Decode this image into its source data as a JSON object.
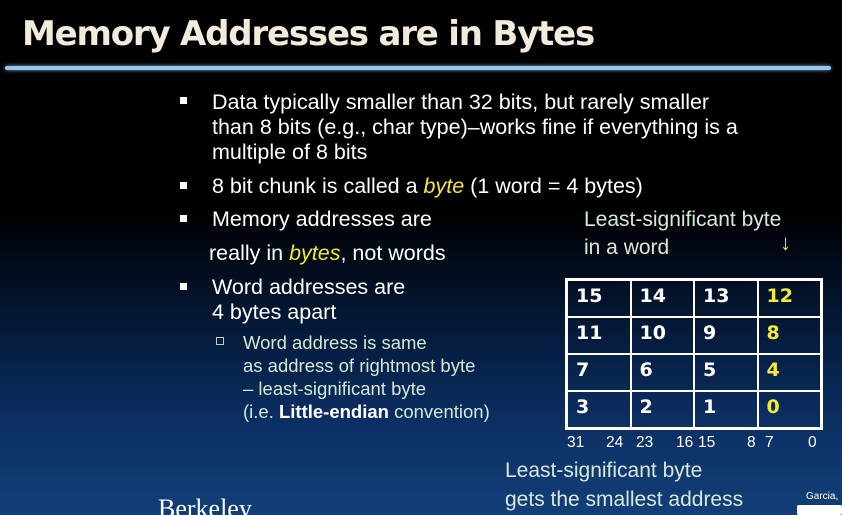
{
  "title": "Memory Addresses are in Bytes",
  "bullets": [
    {
      "lines": [
        "Data typically smaller than 32 bits, but rarely smaller",
        "than 8 bits (e.g., char type)–works fine if everything is a",
        "multiple of 8 bits"
      ]
    },
    {
      "pre": "8 bit chunk is called a ",
      "em": "byte",
      "post": " (1 word = 4 bytes)"
    },
    {
      "line1": "Memory addresses are",
      "pre": "really in ",
      "em": "bytes",
      "post": ", not words"
    },
    {
      "lines": [
        "Word addresses are",
        "4 bytes apart"
      ]
    }
  ],
  "sub_bullet": {
    "lines": [
      "Word address is same",
      "as address of rightmost byte",
      "– least-significant byte"
    ],
    "last_pre": "(i.e. ",
    "last_bold": "Little-endian",
    "last_post": " convention)"
  },
  "lsb_label": [
    "Least-significant byte",
    "in a word"
  ],
  "arrow": "↓",
  "grid": {
    "rows": [
      [
        "15",
        "14",
        "13",
        "12"
      ],
      [
        "11",
        "10",
        "9",
        "8"
      ],
      [
        "7",
        "6",
        "5",
        "4"
      ],
      [
        "3",
        "2",
        "1",
        "0"
      ]
    ]
  },
  "bit_numbers": [
    "31",
    "24",
    "23",
    "16",
    "15",
    "8",
    "7",
    "0"
  ],
  "bottom_label": [
    "Least-significant byte",
    "gets the smallest address"
  ],
  "logo": "Berkeley",
  "footer_author": "Garcia,",
  "colors": {
    "highlight": "#f4e83a",
    "title": "#f2ecdc",
    "rule": "#9fc6e8"
  }
}
